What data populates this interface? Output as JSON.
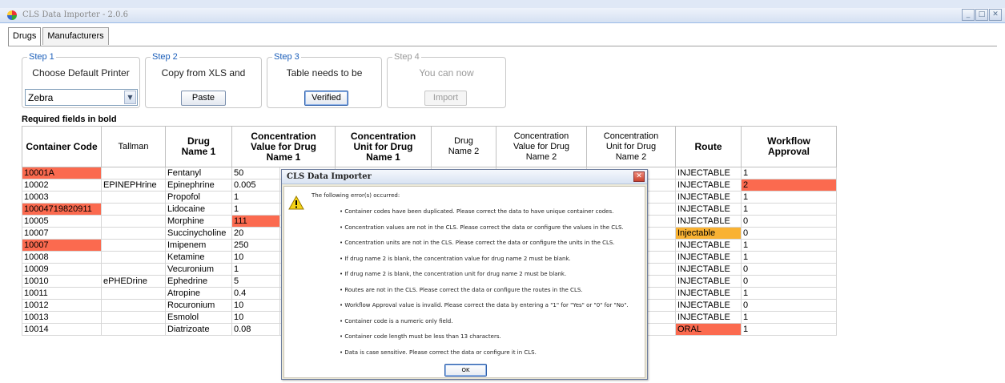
{
  "window": {
    "title": "CLS Data Importer - 2.0.6"
  },
  "tabs": [
    {
      "label": "Drugs",
      "active": true
    },
    {
      "label": "Manufacturers",
      "active": false
    }
  ],
  "steps": [
    {
      "legend": "Step 1",
      "text": "Choose Default Printer",
      "enabled": true
    },
    {
      "legend": "Step 2",
      "text": "Copy from XLS and",
      "button": "Paste",
      "enabled": true
    },
    {
      "legend": "Step 3",
      "text": "Table needs to be",
      "button": "Verified",
      "enabled": true
    },
    {
      "legend": "Step 4",
      "text": "You can now",
      "button": "Import",
      "enabled": false
    }
  ],
  "printer_select": {
    "value": "Zebra"
  },
  "required_note": "Required fields in bold",
  "table": {
    "headers": [
      "Container Code",
      "Tallman",
      "Drug Name 1",
      "Concentration Value for Drug Name 1",
      "Concentration Unit for Drug Name 1",
      "Drug Name 2",
      "Concentration Value for Drug Name 2",
      "Concentration Unit for Drug Name 2",
      "Route",
      "Workflow Approval"
    ],
    "rows": [
      {
        "code": "10001A",
        "tallman": "",
        "drug": "Fentanyl",
        "conc": "50",
        "route": "INJECTABLE",
        "approval": "1"
      },
      {
        "code": "10002",
        "tallman": "EPINEPHrine",
        "drug": "Epinephrine",
        "conc": "0.005",
        "route": "INJECTABLE",
        "approval": "2"
      },
      {
        "code": "10003",
        "tallman": "",
        "drug": "Propofol",
        "conc": "1",
        "route": "INJECTABLE",
        "approval": "1"
      },
      {
        "code": "10004719820911",
        "tallman": "",
        "drug": "Lidocaine",
        "conc": "1",
        "route": "INJECTABLE",
        "approval": "1"
      },
      {
        "code": "10005",
        "tallman": "",
        "drug": "Morphine",
        "conc": "111",
        "route": "INJECTABLE",
        "approval": "0"
      },
      {
        "code": "10007",
        "tallman": "",
        "drug": "Succinycholine",
        "conc": "20",
        "route": "Injectable",
        "approval": "0"
      },
      {
        "code": "10007",
        "tallman": "",
        "drug": "Imipenem",
        "conc": "250",
        "route": "INJECTABLE",
        "approval": "1"
      },
      {
        "code": "10008",
        "tallman": "",
        "drug": "Ketamine",
        "conc": "10",
        "route": "INJECTABLE",
        "approval": "1"
      },
      {
        "code": "10009",
        "tallman": "",
        "drug": "Vecuronium",
        "conc": "1",
        "route": "INJECTABLE",
        "approval": "0"
      },
      {
        "code": "10010",
        "tallman": "ePHEDrine",
        "drug": "Ephedrine",
        "conc": "5",
        "route": "INJECTABLE",
        "approval": "0"
      },
      {
        "code": "10011",
        "tallman": "",
        "drug": "Atropine",
        "conc": "0.4",
        "route": "INJECTABLE",
        "approval": "1"
      },
      {
        "code": "10012",
        "tallman": "",
        "drug": "Rocuronium",
        "conc": "10",
        "route": "INJECTABLE",
        "approval": "0"
      },
      {
        "code": "10013",
        "tallman": "",
        "drug": "Esmolol",
        "conc": "10",
        "route": "INJECTABLE",
        "approval": "1"
      },
      {
        "code": "10014",
        "tallman": "",
        "drug": "Diatrizoate",
        "conc": "0.08",
        "route": "ORAL",
        "approval": "1"
      }
    ]
  },
  "colors": {
    "error": "#fb6a4f",
    "warning": "#f9b233"
  },
  "dialog": {
    "title": "CLS Data Importer",
    "icon": "warning-icon",
    "intro": "The following error(s) occurred:",
    "items": [
      "• Container codes have been duplicated. Please correct the data to have unique container codes.",
      "• Concentration values are not in the CLS. Please correct the data or configure the values in the CLS.",
      "• Concentration units are not in the CLS. Please correct the data or configure the units in the CLS.",
      "• If drug name 2 is blank, the concentration value for drug name 2 must be blank.",
      "• If drug name 2 is blank, the concentration unit for drug name 2 must be blank.",
      "• Routes are not in the CLS. Please correct the data or configure the routes in the CLS.",
      "• Workflow Approval value is invalid. Please correct the data by entering a \"1\" for \"Yes\" or \"0\" for \"No\".",
      "• Container code is a numeric only field.",
      "• Container code length must be less than 13 characters.",
      "• Data is case sensitive. Please correct the data or configure it in CLS."
    ],
    "ok_label": "OK"
  }
}
